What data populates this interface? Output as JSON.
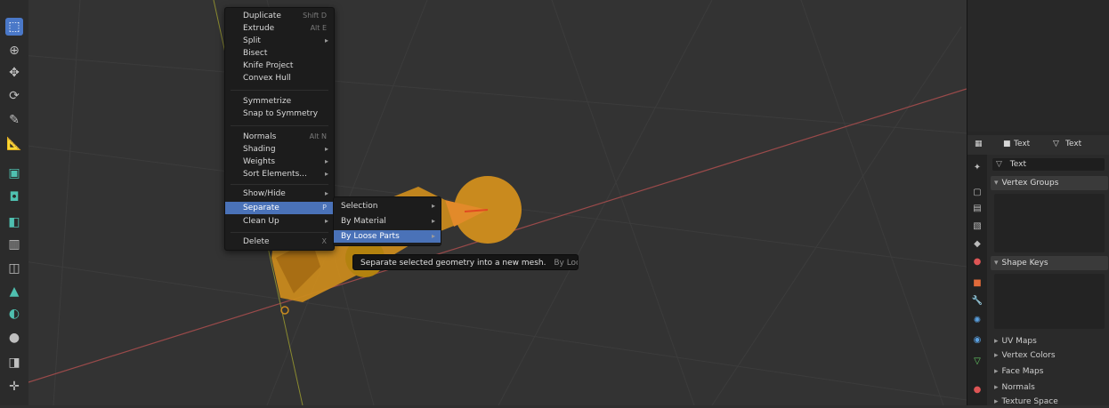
{
  "edit_menu": {
    "items": [
      {
        "label": "Duplicate",
        "shortcut": "Shift D"
      },
      {
        "label": "Extrude",
        "shortcut": "Alt E"
      },
      {
        "label": "Split",
        "submenu": true
      },
      {
        "label": "Bisect"
      },
      {
        "label": "Knife Project"
      },
      {
        "label": "Convex Hull"
      },
      {
        "label": "Symmetrize"
      },
      {
        "label": "Snap to Symmetry"
      },
      {
        "label": "Normals",
        "shortcut": "Alt N"
      },
      {
        "label": "Shading",
        "submenu": true
      },
      {
        "label": "Weights",
        "submenu": true
      },
      {
        "label": "Sort Elements...",
        "submenu": true
      },
      {
        "label": "Show/Hide",
        "submenu": true
      },
      {
        "label": "Separate",
        "shortcut": "P"
      },
      {
        "label": "Clean Up",
        "submenu": true
      },
      {
        "label": "Delete",
        "shortcut": "X"
      }
    ]
  },
  "separate_submenu": {
    "items": [
      "Selection",
      "By Material",
      "By Loose Parts"
    ]
  },
  "tooltip": {
    "text": "Separate selected geometry into a new mesh.",
    "python": "By Loose Parts"
  },
  "properties": {
    "header": {
      "object_name": "Text",
      "data_name": "Text"
    },
    "mesh_field": "Text",
    "panels": {
      "vertex_groups": "Vertex Groups",
      "shape_keys": "Shape Keys",
      "uv_maps": "UV Maps",
      "vertex_colors": "Vertex Colors",
      "face_maps": "Face Maps",
      "normals": "Normals",
      "texture_space": "Texture Space"
    }
  },
  "colors": {
    "accent": "#4a72b8",
    "object_orange": "#c98a1e",
    "grid_line": "#3c3c3c",
    "axis_red": "#9a4a4a",
    "axis_yellow": "#8a8a30"
  }
}
